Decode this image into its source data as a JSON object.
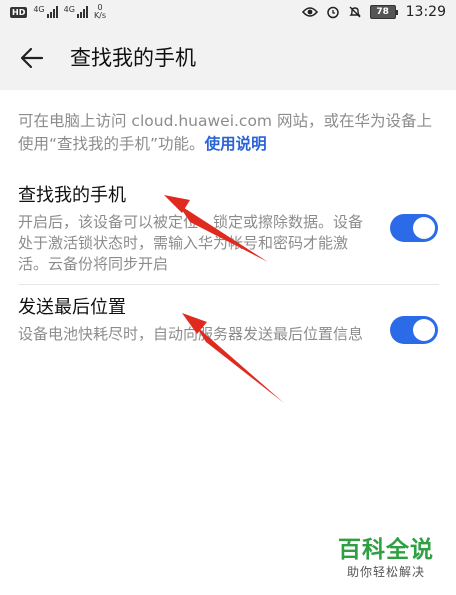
{
  "status_bar": {
    "hd_label": "HD",
    "sim_label_1": "4G",
    "sim_label_2": "4G",
    "net_speed_value": "0",
    "net_speed_unit": "K/s",
    "battery": "78",
    "time": "13:29"
  },
  "header": {
    "title": "查找我的手机",
    "back_icon": "arrow-left-icon"
  },
  "intro": {
    "text": "可在电脑上访问 cloud.huawei.com 网站，或在华为设备上使用“查找我的手机”功能。",
    "link": "使用说明"
  },
  "settings": [
    {
      "title": "查找我的手机",
      "description": "开启后，该设备可以被定位、锁定或擦除数据。设备处于激活锁状态时，需输入华为帐号和密码才能激活。云备份将同步开启",
      "enabled": true
    },
    {
      "title": "发送最后位置",
      "description": "设备电池快耗尽时，自动向服务器发送最后位置信息",
      "enabled": true
    }
  ],
  "colors": {
    "accent": "#2c6be8",
    "annotation": "#e02a1f",
    "watermark": "#2ea043"
  },
  "watermark": {
    "title": "百科全说",
    "subtitle": "助你轻松解决"
  }
}
